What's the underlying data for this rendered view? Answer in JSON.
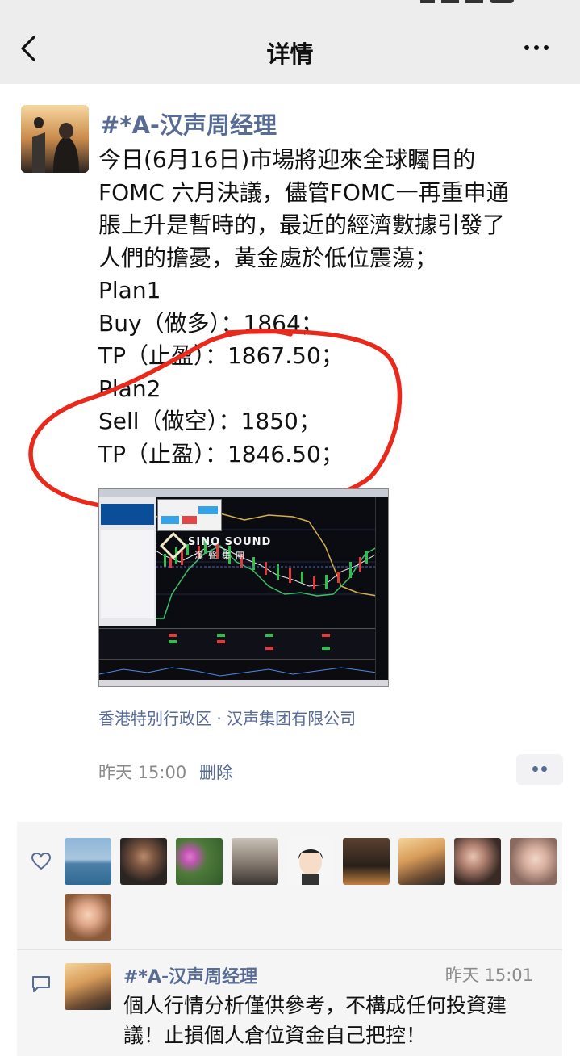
{
  "header": {
    "title": "详情"
  },
  "post": {
    "author": "#*A-汉声周经理",
    "lines": [
      "今日(6月16日)市場將迎來全球矚目的",
      "FOMC 六月決議，儘管FOMC一再重申通",
      "脹上升是暫時的，最近的經濟數據引發了",
      "人們的擔憂，黃金處於低位震蕩；",
      "Plan1",
      "Buy（做多）：1864；",
      "TP（止盈）：1867.50；",
      "Plan2",
      "Sell（做空）：1850；",
      "TP（止盈）：1846.50；"
    ],
    "image": {
      "logo_text": "SINO SOUND",
      "logo_sub": "漢聲集團"
    },
    "location": "香港特别行政区 · 汉声集团有限公司",
    "time": "昨天 15:00",
    "delete_label": "删除"
  },
  "likes": {
    "avatars": [
      "avatar-sea",
      "avatar-man",
      "avatar-flowers",
      "avatar-room",
      "avatar-cartoon",
      "avatar-office",
      "avatar-sunset",
      "avatar-couple",
      "avatar-girl",
      "avatar-woman"
    ]
  },
  "comment": {
    "author": "#*A-汉声周经理",
    "time": "昨天 15:01",
    "lines": [
      "個人行情分析僅供參考，不構成任何投資建",
      "議！止損個人倉位資金自己把控！"
    ]
  },
  "colors": {
    "link": "#576b95",
    "annotation": "#e8291c",
    "background": "#ffffff",
    "header_bg": "#ededed",
    "likes_bg": "#f5f5f5"
  }
}
